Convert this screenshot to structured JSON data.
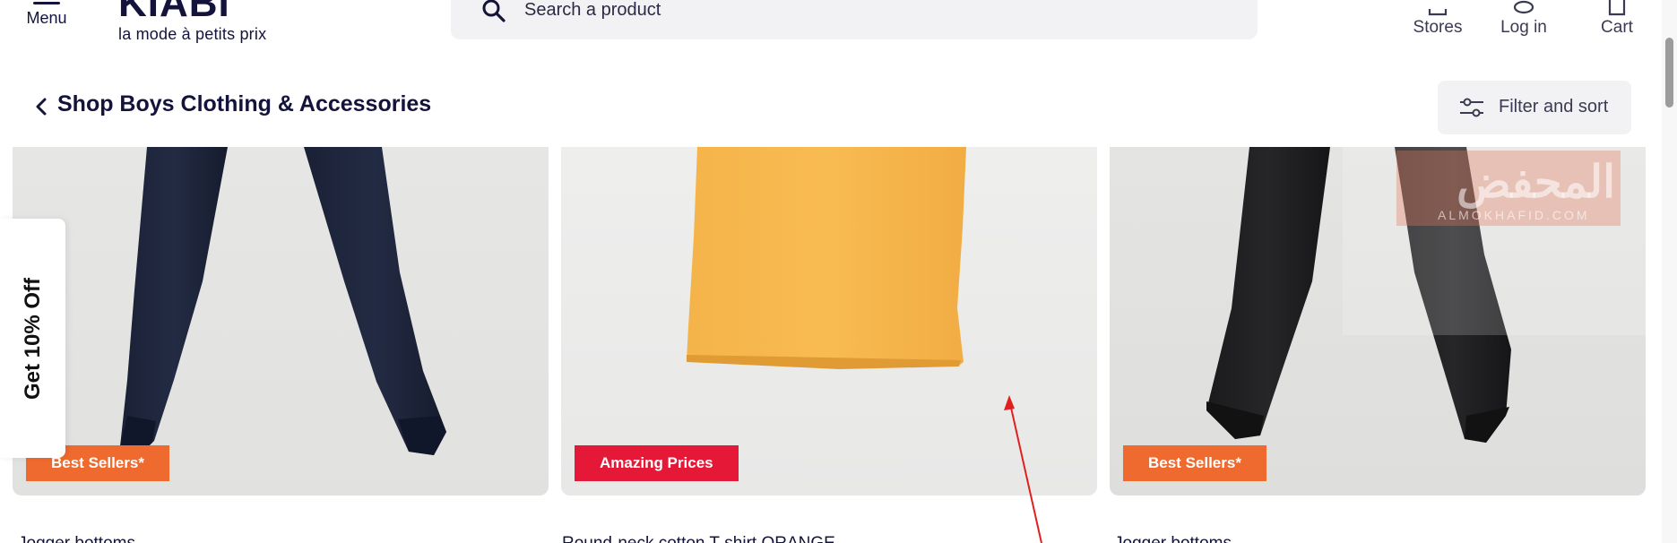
{
  "header": {
    "menu_label": "Menu",
    "logo_word": "KIABI",
    "logo_tagline": "la mode à petits prix",
    "search_placeholder": "Search a product",
    "stores_label": "Stores",
    "login_label": "Log in",
    "cart_label": "Cart"
  },
  "subheader": {
    "title": "Shop Boys Clothing & Accessories",
    "filter_label": "Filter and sort"
  },
  "products": [
    {
      "badge": "Best Sellers*",
      "badge_color": "#ef6a2e",
      "name": "Jogger bottoms",
      "item": "navy-jogger-pants"
    },
    {
      "badge": "Amazing Prices",
      "badge_color": "#e51837",
      "name": "Round-neck cotton T-shirt ORANGE",
      "item": "orange-t-shirt"
    },
    {
      "badge": "Best Sellers*",
      "badge_color": "#ef6a2e",
      "name": "Jogger bottoms",
      "item": "black-jogger-pants"
    }
  ],
  "promo": {
    "label": "Get 10% Off"
  },
  "watermark": {
    "arabic": "المحفض",
    "latin": "ALMOKHAFID.COM"
  },
  "colors": {
    "brand_navy": "#14133b",
    "badge_orange": "#ef6a2e",
    "badge_red": "#e51837",
    "arrow_red": "#e02020"
  }
}
